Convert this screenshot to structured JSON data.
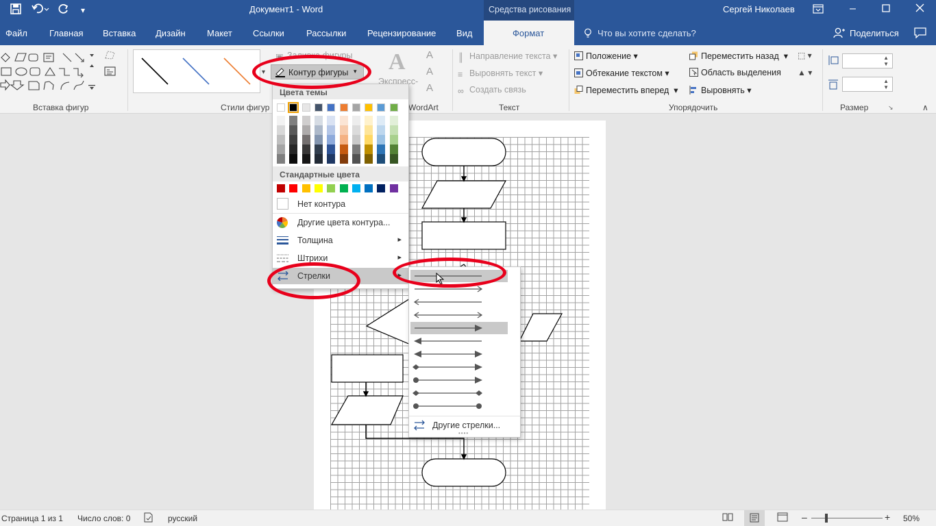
{
  "titlebar": {
    "doc_title": "Документ1  -  Word",
    "context_title": "Средства рисования",
    "user": "Сергей Николаев",
    "icons": [
      "save-icon",
      "undo-icon",
      "redo-icon",
      "customize-icon",
      "ribbon-display-icon",
      "minimize-icon",
      "maximize-icon",
      "close-icon"
    ]
  },
  "tabs": [
    "Файл",
    "Главная",
    "Вставка",
    "Дизайн",
    "Макет",
    "Ссылки",
    "Рассылки",
    "Рецензирование",
    "Вид",
    "Формат"
  ],
  "tell_me": "Что вы хотите сделать?",
  "share": "Поделиться",
  "ribbon": {
    "groups": {
      "insert_shapes": "Вставка фигур",
      "shape_styles": "Стили фигур",
      "wordart": "WordArt",
      "text": "Текст",
      "arrange": "Упорядочить",
      "size": "Размер"
    },
    "shape_fill": "Заливка фигуры",
    "shape_outline": "Контур фигуры",
    "express": "Экспресс-",
    "text_direction": "Направление текста",
    "align_text": "Выровнять текст",
    "create_link": "Создать связь",
    "position": "Положение",
    "wrap_text": "Обтекание текстом",
    "bring_forward": "Переместить вперед",
    "send_backward": "Переместить назад",
    "selection_pane": "Область выделения",
    "align": "Выровнять"
  },
  "outline_menu": {
    "theme_colors": "Цвета темы",
    "standard_colors": "Стандартные цвета",
    "no_outline": "Нет контура",
    "more_colors": "Другие цвета контура...",
    "weight": "Толщина",
    "dashes": "Штрихи",
    "arrows": "Стрелки",
    "theme_top_row": [
      "#ffffff",
      "#000000",
      "#e7e6e6",
      "#44546a",
      "#4472c4",
      "#ed7d31",
      "#a5a5a5",
      "#ffc000",
      "#5b9bd5",
      "#70ad47"
    ],
    "theme_shades": [
      [
        "#f2f2f2",
        "#7f7f7f",
        "#d0cece",
        "#d6dce4",
        "#d9e2f3",
        "#fbe5d5",
        "#ededed",
        "#fff2cc",
        "#deebf6",
        "#e2efd9"
      ],
      [
        "#d8d8d8",
        "#595959",
        "#aeabab",
        "#adb9ca",
        "#b4c6e7",
        "#f7cbac",
        "#dbdbdb",
        "#fee599",
        "#bdd7ee",
        "#c5e0b3"
      ],
      [
        "#bfbfbf",
        "#3f3f3f",
        "#757070",
        "#8496b0",
        "#8eaadb",
        "#f4b183",
        "#c9c9c9",
        "#ffd965",
        "#9cc3e5",
        "#a8d08d"
      ],
      [
        "#a5a5a5",
        "#262626",
        "#3a3838",
        "#323f4f",
        "#2f5496",
        "#c55a11",
        "#7b7b7b",
        "#bf8f00",
        "#2e75b5",
        "#538135"
      ],
      [
        "#7f7f7f",
        "#0c0c0c",
        "#171616",
        "#222a35",
        "#1f3864",
        "#833c0b",
        "#525252",
        "#7f6000",
        "#1e4e79",
        "#375623"
      ]
    ],
    "standard": [
      "#c00000",
      "#ff0000",
      "#ffc000",
      "#ffff00",
      "#92d050",
      "#00b050",
      "#00b0f0",
      "#0070c0",
      "#002060",
      "#7030a0"
    ]
  },
  "arrows_menu": {
    "more_arrows": "Другие стрелки..."
  },
  "status": {
    "page": "Страница 1 из 1",
    "words": "Число слов: 0",
    "language": "русский",
    "zoom": "50%"
  }
}
